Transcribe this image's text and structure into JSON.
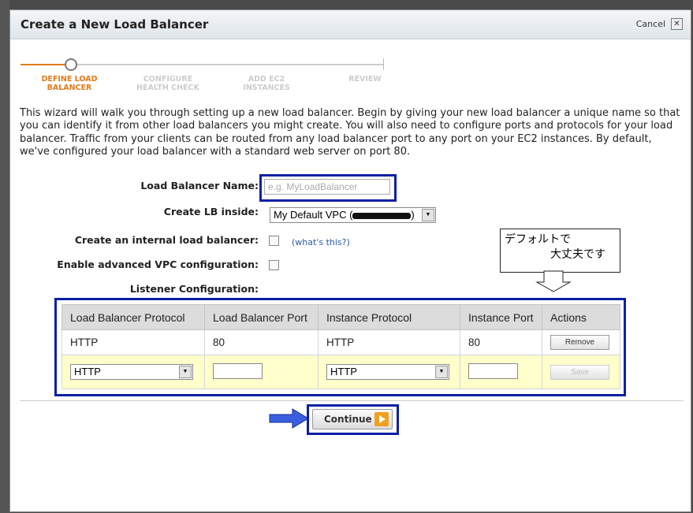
{
  "dialog": {
    "title": "Create a New Load Balancer",
    "cancel_label": "Cancel",
    "close_glyph": "✕"
  },
  "wizard": {
    "steps": [
      {
        "line1": "DEFINE LOAD",
        "line2": "BALANCER"
      },
      {
        "line1": "CONFIGURE",
        "line2": "HEALTH CHECK"
      },
      {
        "line1": "ADD EC2",
        "line2": "INSTANCES"
      },
      {
        "line1": "REVIEW",
        "line2": ""
      }
    ],
    "active_step": 0,
    "accent_color": "#e07b1c"
  },
  "intro_text": "This wizard will walk you through setting up a new load balancer. Begin by giving your new load balancer a unique name so that you can identify it from other load balancers you might create. You will also need to configure ports and protocols for your load balancer. Traffic from your clients can be routed from any load balancer port to any port on your EC2 instances. By default, we've configured your load balancer with a standard web server on port 80.",
  "form": {
    "name_label": "Load Balancer Name:",
    "name_placeholder": "e.g. MyLoadBalancer",
    "name_value": "",
    "inside_label": "Create LB inside:",
    "inside_value_prefix": "My Default VPC (",
    "inside_value_suffix": ")",
    "internal_label": "Create an internal load balancer:",
    "internal_checked": false,
    "help_link": "(what's this?)",
    "advanced_label": "Enable advanced VPC configuration:",
    "advanced_checked": false,
    "listener_label": "Listener Configuration:"
  },
  "listeners": {
    "headers": [
      "Load Balancer Protocol",
      "Load Balancer Port",
      "Instance Protocol",
      "Instance Port",
      "Actions"
    ],
    "rows": [
      {
        "lb_protocol": "HTTP",
        "lb_port": "80",
        "instance_protocol": "HTTP",
        "instance_port": "80",
        "action": "Remove"
      }
    ],
    "new_row": {
      "lb_protocol": "HTTP",
      "lb_port": "",
      "instance_protocol": "HTTP",
      "instance_port": "",
      "action": "Save"
    }
  },
  "callout": {
    "line1": "デフォルトで",
    "line2": "大丈夫です"
  },
  "continue_label": "Continue",
  "highlight_color": "#0a1fa5",
  "arrow_color": "#3a5fe0"
}
